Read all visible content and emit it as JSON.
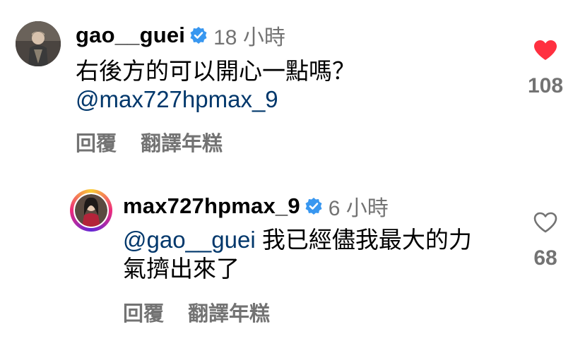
{
  "comments": [
    {
      "username": "gao__guei",
      "timestamp": "18 小時",
      "text": "右後方的可以開心一點嗎？",
      "mention": "@max727hpmax_9",
      "actions": {
        "reply": "回覆",
        "translate": "翻譯年糕"
      },
      "likes": "108",
      "liked": true
    },
    {
      "username": "max727hpmax_9",
      "timestamp": "6 小時",
      "mention": "@gao__guei",
      "text_line1": " 我已經儘我最大的力",
      "text_line2": "氣擠出來了",
      "actions": {
        "reply": "回覆",
        "translate": "翻譯年糕"
      },
      "likes": "68",
      "liked": false
    }
  ],
  "colors": {
    "verified": "#3897f0",
    "like_red": "#ff3040",
    "mention": "#00376b",
    "muted": "#737373"
  }
}
